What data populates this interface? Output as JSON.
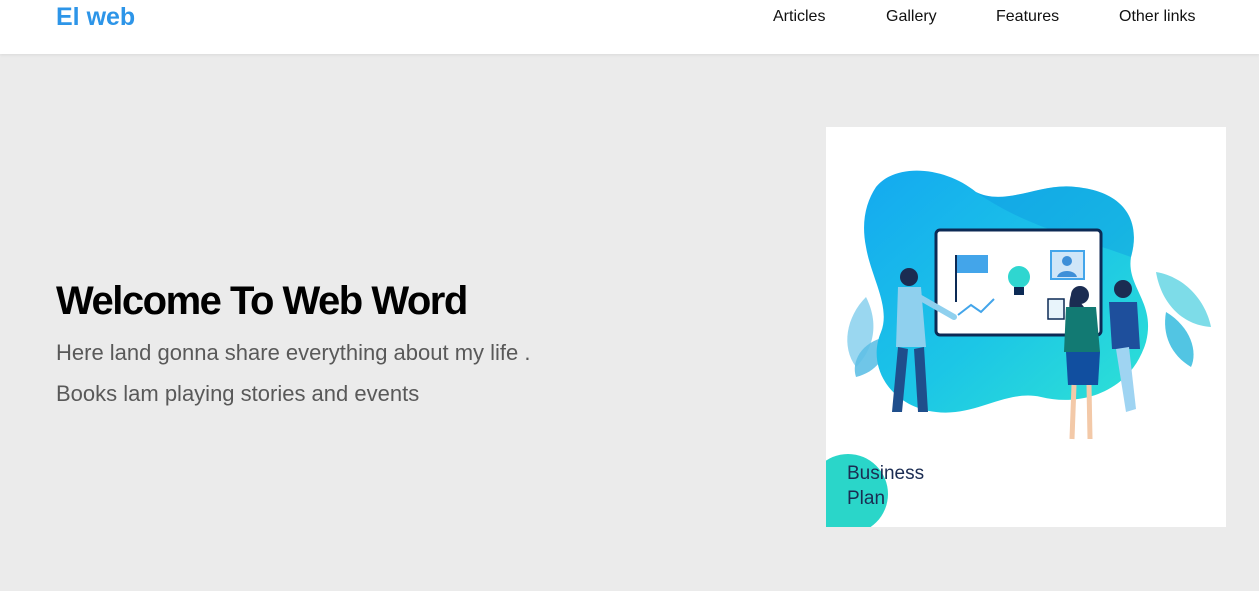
{
  "header": {
    "logo": "El web",
    "nav": [
      {
        "label": "Articles"
      },
      {
        "label": "Gallery"
      },
      {
        "label": "Features"
      },
      {
        "label": "Other links"
      }
    ]
  },
  "hero": {
    "title": "Welcome To Web Word",
    "description": "Here land gonna share everything about my life . Books lam playing stories and events",
    "image": {
      "caption_line1": "Business",
      "caption_line2": "Plan"
    }
  },
  "colors": {
    "brand": "#2d95e8",
    "page_background": "#ebebeb",
    "navbar_background": "#ffffff"
  }
}
